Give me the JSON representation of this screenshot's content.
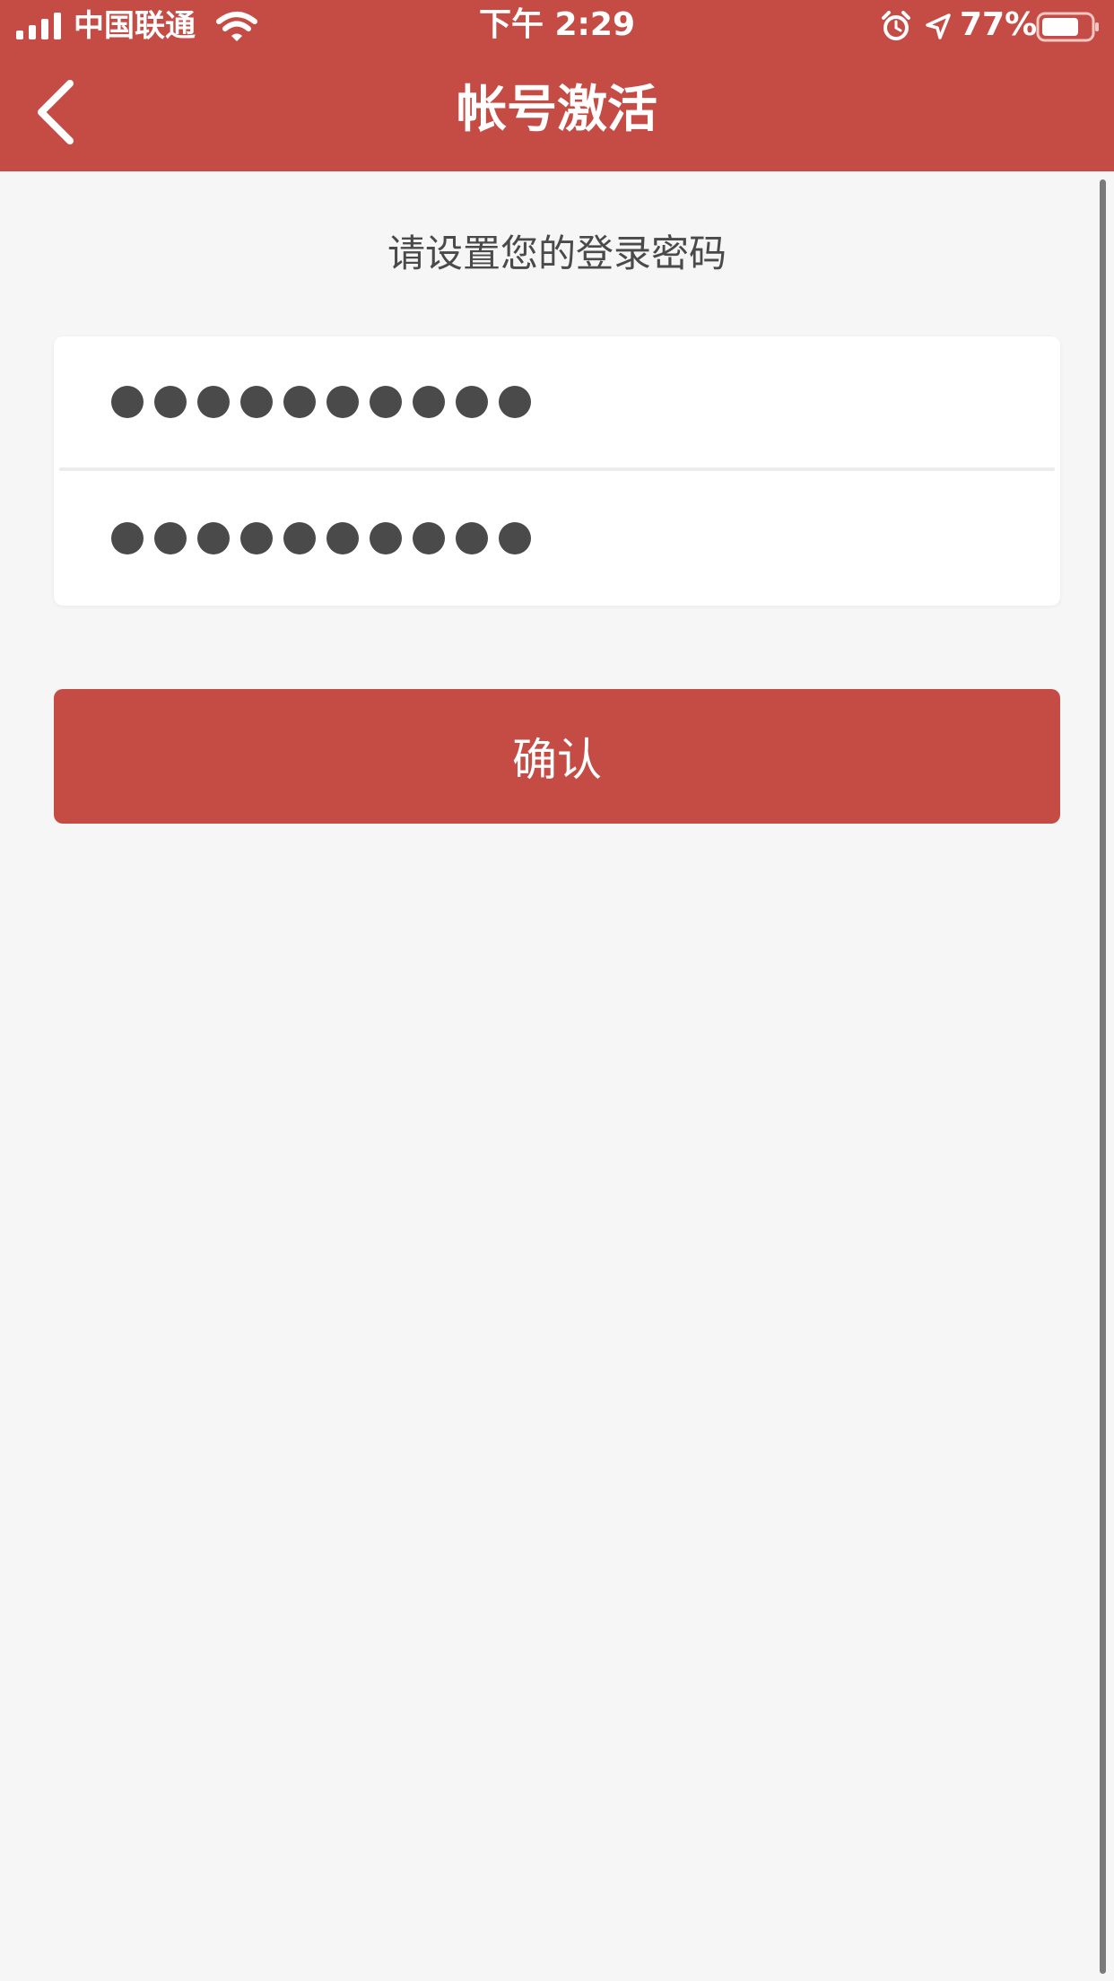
{
  "status_bar": {
    "carrier": "中国联通",
    "time": "下午 2:29",
    "battery_percent": "77%",
    "icons": [
      "signal-icon",
      "wifi-icon",
      "alarm-icon",
      "location-icon",
      "battery-icon"
    ]
  },
  "nav": {
    "title": "帐号激活",
    "back_icon": "chevron-left-icon"
  },
  "form": {
    "subtitle": "请设置您的登录密码",
    "password_value": "••••••••••",
    "confirm_password_value": "••••••••••",
    "confirm_label": "确认"
  },
  "colors": {
    "brand": "#c54b45",
    "background": "#f6f6f6",
    "card": "#ffffff",
    "text": "#4a4a4a"
  }
}
